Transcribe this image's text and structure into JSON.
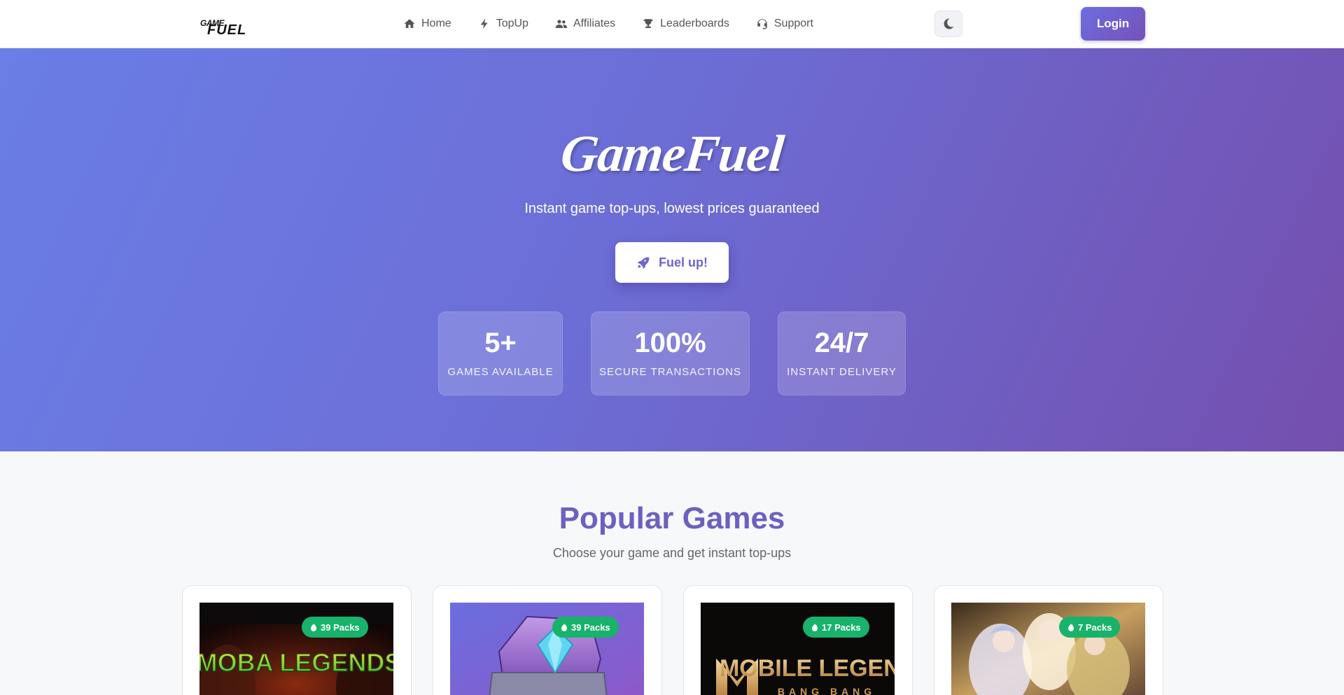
{
  "nav": {
    "logo_top": "GAME",
    "logo_bottom": "FUEL",
    "items": [
      {
        "label": "Home",
        "icon": "home-icon"
      },
      {
        "label": "TopUp",
        "icon": "bolt-icon"
      },
      {
        "label": "Affiliates",
        "icon": "users-icon"
      },
      {
        "label": "Leaderboards",
        "icon": "trophy-icon"
      },
      {
        "label": "Support",
        "icon": "headset-icon"
      }
    ],
    "theme_icon": "moon-icon",
    "login_label": "Login"
  },
  "hero": {
    "title": "GameFuel",
    "subtitle": "Instant game top-ups, lowest prices guaranteed",
    "cta_label": "Fuel up!",
    "cta_icon": "rocket-icon",
    "stats": [
      {
        "value": "5+",
        "label": "GAMES AVAILABLE"
      },
      {
        "value": "100%",
        "label": "SECURE TRANSACTIONS"
      },
      {
        "value": "24/7",
        "label": "INSTANT DELIVERY"
      }
    ]
  },
  "popular": {
    "title": "Popular Games",
    "subtitle": "Choose your game and get instant top-ups",
    "games": [
      {
        "badge": "39 Packs",
        "image_label": "MOBA LEGENDS"
      },
      {
        "badge": "39 Packs",
        "image_label": ""
      },
      {
        "badge": "17 Packs",
        "image_label": "MOBILE LEGENDS",
        "image_sublabel": "BANG BANG"
      },
      {
        "badge": "7 Packs",
        "image_label": ""
      }
    ]
  },
  "colors": {
    "accent": "#6d60c0",
    "badge": "#18b26b",
    "hero_start": "#6a7ee6",
    "hero_end": "#744fae"
  }
}
